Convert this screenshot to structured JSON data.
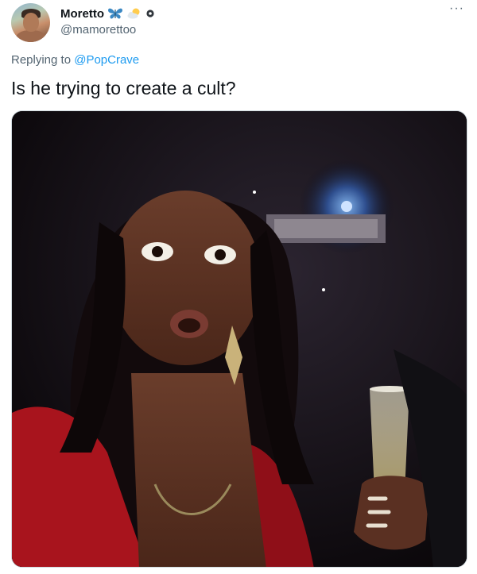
{
  "tweet": {
    "display_name": "Moretto",
    "handle": "@mamorettoo",
    "name_emojis": [
      "butterfly-icon",
      "sun-behind-cloud-icon"
    ],
    "more_label": "···",
    "replying_prefix": "Replying to ",
    "replying_mention": "@PopCrave",
    "text": "Is he trying to create a cult?"
  },
  "colors": {
    "text": "#0f1419",
    "secondary": "#536471",
    "link": "#1d9bf0",
    "border": "#cfd9de"
  }
}
